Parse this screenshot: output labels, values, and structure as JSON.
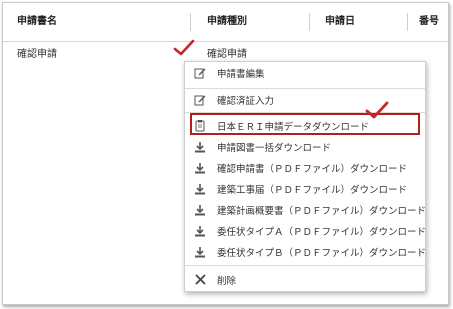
{
  "table": {
    "headers": [
      "申請書名",
      "申請種別",
      "申請日",
      "番号"
    ],
    "row": {
      "name": "確認申請",
      "type": "確認申請"
    }
  },
  "menu": {
    "items": [
      {
        "label": "申請書編集",
        "icon": "edit-icon"
      },
      {
        "label": "確認済証入力",
        "icon": "edit-icon"
      },
      {
        "label": "日本ＥＲＩ申請データダウンロード",
        "icon": "clipboard-icon"
      },
      {
        "label": "申請図書一括ダウンロード",
        "icon": "download-icon"
      },
      {
        "label": "確認申請書（ＰＤＦファイル）ダウンロード",
        "icon": "download-icon"
      },
      {
        "label": "建築工事届（ＰＤＦファイル）ダウンロード",
        "icon": "download-icon"
      },
      {
        "label": "建築計画概要書（ＰＤＦファイル）ダウンロード",
        "icon": "download-icon"
      },
      {
        "label": "委任状タイプＡ（ＰＤＦファイル）ダウンロード",
        "icon": "download-icon"
      },
      {
        "label": "委任状タイプＢ（ＰＤＦファイル）ダウンロード",
        "icon": "download-icon"
      },
      {
        "label": "削除",
        "icon": "close-icon"
      }
    ]
  },
  "colors": {
    "highlight_border": "#b71c1c",
    "checkmark": "#c62828"
  }
}
